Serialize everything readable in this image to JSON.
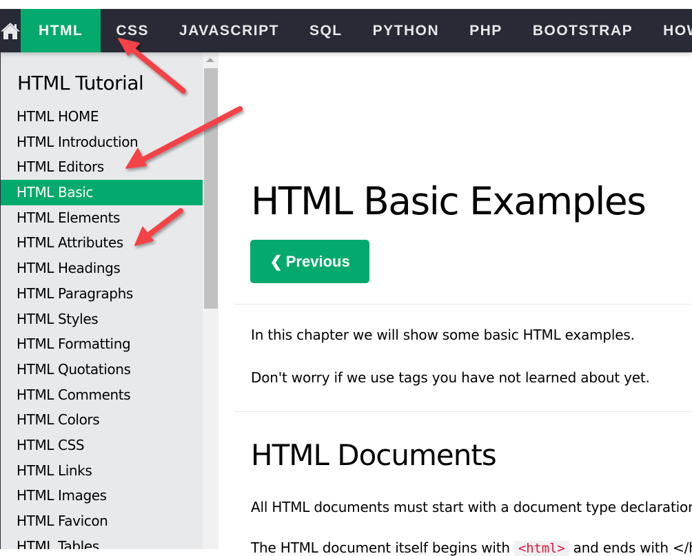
{
  "navbar": {
    "home_icon": "home-icon",
    "items": [
      {
        "label": "HTML",
        "active": true
      },
      {
        "label": "CSS"
      },
      {
        "label": "JAVASCRIPT"
      },
      {
        "label": "SQL"
      },
      {
        "label": "PYTHON"
      },
      {
        "label": "PHP"
      },
      {
        "label": "BOOTSTRAP"
      },
      {
        "label": "HOW TO"
      }
    ]
  },
  "sidebar": {
    "title": "HTML Tutorial",
    "items": [
      {
        "label": "HTML HOME"
      },
      {
        "label": "HTML Introduction"
      },
      {
        "label": "HTML Editors"
      },
      {
        "label": "HTML Basic",
        "active": true
      },
      {
        "label": "HTML Elements"
      },
      {
        "label": "HTML Attributes"
      },
      {
        "label": "HTML Headings"
      },
      {
        "label": "HTML Paragraphs"
      },
      {
        "label": "HTML Styles"
      },
      {
        "label": "HTML Formatting"
      },
      {
        "label": "HTML Quotations"
      },
      {
        "label": "HTML Comments"
      },
      {
        "label": "HTML Colors"
      },
      {
        "label": "HTML CSS"
      },
      {
        "label": "HTML Links"
      },
      {
        "label": "HTML Images"
      },
      {
        "label": "HTML Favicon"
      },
      {
        "label": "HTML Tables"
      }
    ]
  },
  "main": {
    "title": "HTML Basic Examples",
    "prev_button": {
      "chevron": "❮",
      "label": "Previous"
    },
    "intro_1": "In this chapter we will show some basic HTML examples.",
    "intro_2": "Don't worry if we use tags you have not learned about yet.",
    "section_title": "HTML Documents",
    "doc_1": "All HTML documents must start with a document type declaration: <!DOCTYPE html>.",
    "doc_2_before": "The HTML document itself begins with ",
    "doc_2_code": "<html>",
    "doc_2_after": " and ends with </html>."
  },
  "colors": {
    "accent": "#04aa6d",
    "navbar_bg": "#282a35",
    "sidebar_bg": "#e7e9eb",
    "annotation_arrow": "#f44346",
    "code_text": "#dc143c"
  }
}
